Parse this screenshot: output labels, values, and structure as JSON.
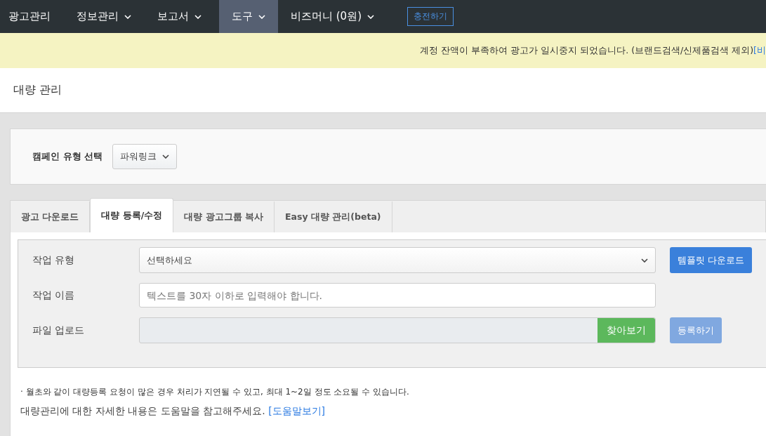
{
  "nav": {
    "items": [
      {
        "label": "광고관리",
        "dropdown": false,
        "selected": false
      },
      {
        "label": "정보관리",
        "dropdown": true,
        "selected": false
      },
      {
        "label": "보고서",
        "dropdown": true,
        "selected": false
      },
      {
        "label": "도구",
        "dropdown": true,
        "selected": true
      },
      {
        "label": "비즈머니 (0원)",
        "dropdown": true,
        "selected": false
      }
    ],
    "charge_button": "충전하기"
  },
  "banner": {
    "message": "계정 잔액이 부족하여 광고가 일시중지 되었습니다. (브랜드검색/신제품검색 제외)",
    "link": "[비"
  },
  "page_title": "대량 관리",
  "campaign": {
    "label": "캠페인 유형 선택",
    "value": "파워링크"
  },
  "tabs": [
    {
      "label": "광고 다운로드",
      "selected": false
    },
    {
      "label": "대량 등록/수정",
      "selected": true
    },
    {
      "label": "대량 광고그룹 복사",
      "selected": false
    },
    {
      "label": "Easy 대량 관리(beta)",
      "selected": false
    }
  ],
  "form": {
    "job_type": {
      "label": "작업 유형",
      "value": "선택하세요"
    },
    "template_button": "템플릿 다운로드",
    "job_name": {
      "label": "작업 이름",
      "placeholder": "텍스트를 30자 이하로 입력해야 합니다."
    },
    "file_upload": {
      "label": "파일 업로드",
      "browse_button": "찾아보기"
    },
    "register_button": {
      "label": "등록하기",
      "disabled": true
    }
  },
  "notes": {
    "bullet": "· 월초와 같이 대량등록 요청이 많은 경우 처리가 지연될 수 있고, 최대 1~2일 정도 소요될 수 있습니다.",
    "help_text": "대량관리에 대한 자세한 내용은 도움말을 참고해주세요.",
    "help_link": "[도움말보기]"
  }
}
